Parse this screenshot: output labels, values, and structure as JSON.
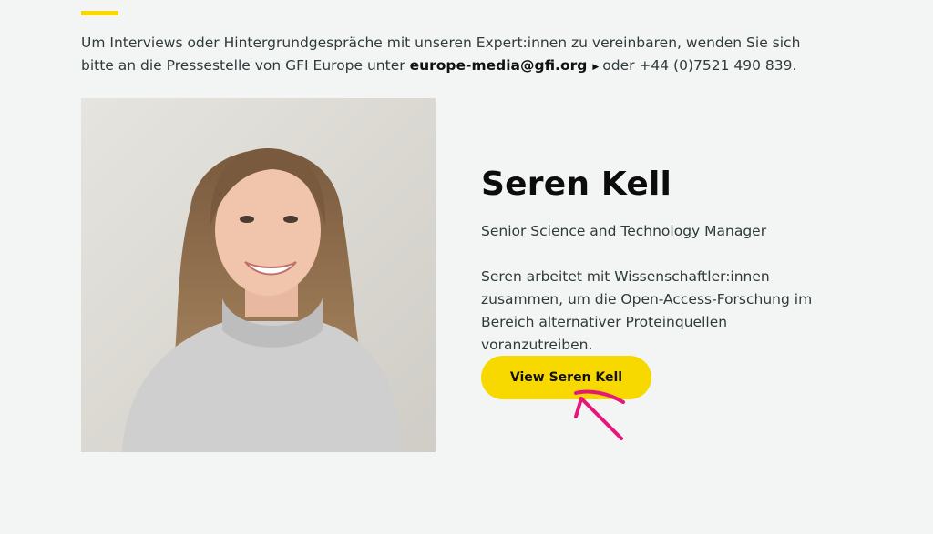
{
  "intro": {
    "text_before": "Um Interviews oder Hintergrundgespräche mit unseren Expert:innen zu vereinbaren, wenden Sie sich bitte an die Pressestelle von GFI Europe unter",
    "email": "europe-media@gfi.org",
    "text_after": "oder +44 (0)7521 490 839."
  },
  "profile": {
    "name": "Seren Kell",
    "role": "Senior Science and Technology Manager",
    "bio": "Seren arbeitet mit Wissenschaftler:innen zusammen, um die Open-Access-Forschung im Bereich alternativer Proteinquellen voranzutreiben.",
    "cta_label": "View Seren Kell"
  },
  "colors": {
    "accent": "#f7d900",
    "background": "#f3f5f4",
    "pointer": "#e6177a"
  },
  "icons": {
    "link_caret": "caret-right-icon",
    "pointer": "hand-drawn-arrow-icon"
  }
}
